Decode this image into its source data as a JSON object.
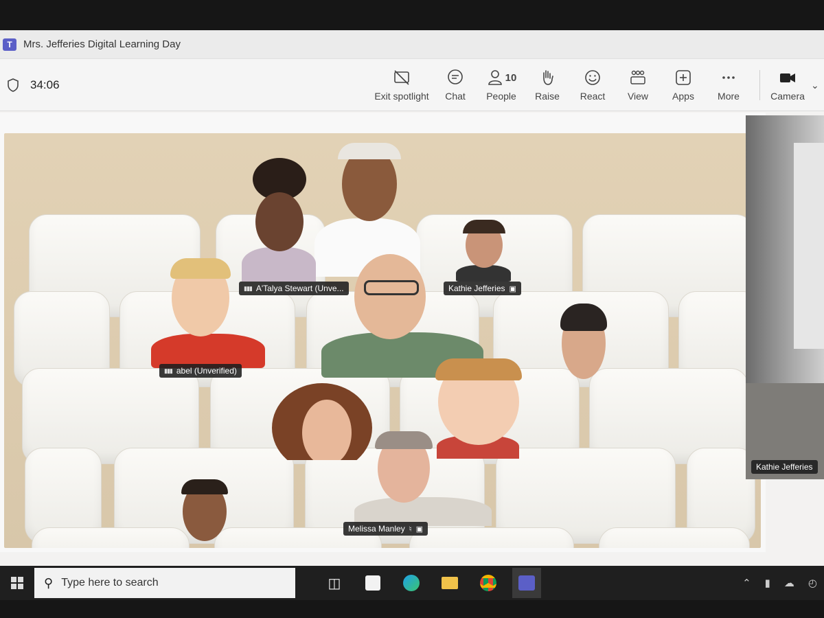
{
  "window": {
    "title": "Mrs. Jefferies Digital Learning Day",
    "app_icon": "teams-icon"
  },
  "toolbar": {
    "timer": "34:06",
    "items": [
      {
        "label": "Exit spotlight",
        "icon": "exit-spotlight-icon"
      },
      {
        "label": "Chat",
        "icon": "chat-icon"
      },
      {
        "label": "People",
        "icon": "people-icon",
        "count": "10"
      },
      {
        "label": "Raise",
        "icon": "raise-hand-icon"
      },
      {
        "label": "React",
        "icon": "react-icon"
      },
      {
        "label": "View",
        "icon": "view-icon"
      },
      {
        "label": "Apps",
        "icon": "apps-icon"
      },
      {
        "label": "More",
        "icon": "more-icon"
      },
      {
        "label": "Camera",
        "icon": "camera-icon"
      }
    ]
  },
  "participants": [
    {
      "name": "A'Talya Stewart (Unve..."
    },
    {
      "name": "Kathie Jefferies"
    },
    {
      "name": "abel (Unverified)"
    },
    {
      "name": "Melissa Manley"
    }
  ],
  "side_video": {
    "name": "Kathie Jefferies"
  },
  "taskbar": {
    "search_placeholder": "Type here to search"
  },
  "colors": {
    "teams_brand": "#5b5fc7",
    "taskbar_bg": "#1f1f1f"
  }
}
